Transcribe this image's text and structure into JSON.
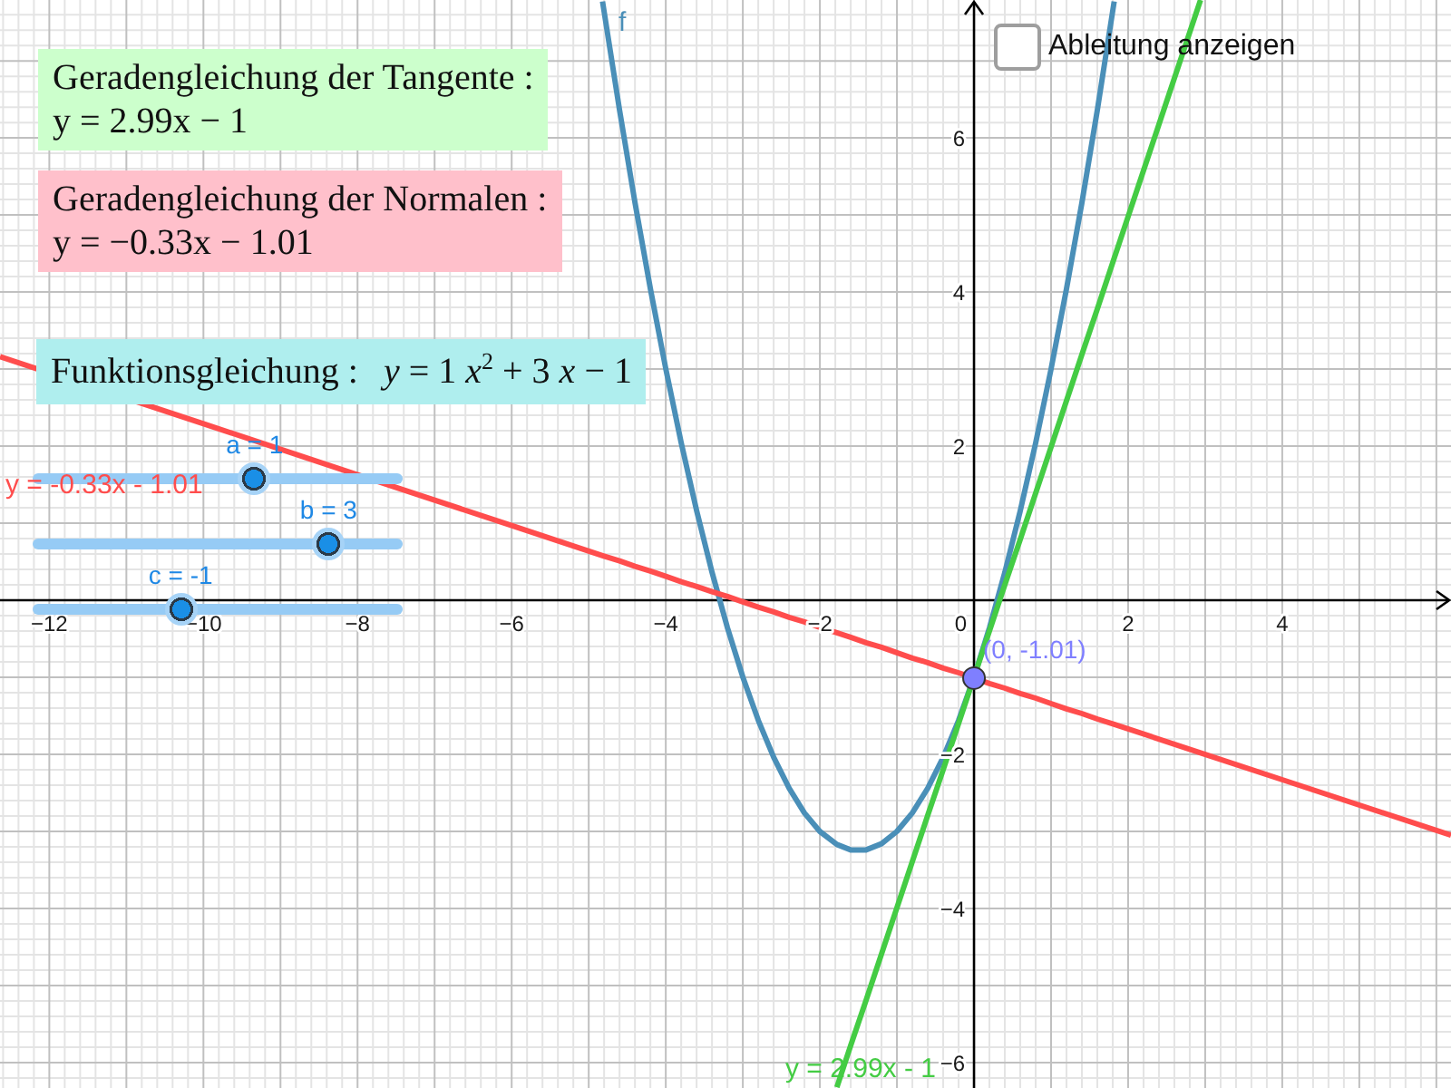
{
  "text_boxes": [
    {
      "kind": "stacked",
      "title": "Geradengleichung der Tangente :",
      "equation": "y = 2.99x − 1",
      "color": "#ccffcc"
    },
    {
      "kind": "stacked",
      "title": "Geradengleichung der Normalen :",
      "equation": "y = −0.33x − 1.01",
      "color": "#ffc0cb"
    },
    {
      "kind": "inline",
      "title": "Funktionsgleichung :",
      "equation": "*y* = 1 *x*$^{2}$ + 3 *x* − 1",
      "color": "#afeeee"
    }
  ],
  "checkbox": {
    "label": "Ableitung anzeigen",
    "checked": false
  },
  "sliders": [
    {
      "label": "a = 1",
      "level": 0.6
    },
    {
      "label": "b = 3",
      "level": 0.8
    },
    {
      "label": "c = -1",
      "level": 0.4
    }
  ],
  "graph": {
    "origin_label": "0",
    "chart_data": {
      "type": "line",
      "grid": true,
      "xlim": [
        -12.64,
        6.19
      ],
      "ylim": [
        -6.33,
        7.79
      ],
      "xticks": [
        {
          "value": -12,
          "label": "−12"
        },
        {
          "value": -10,
          "label": "−10"
        },
        {
          "value": -8,
          "label": "−8"
        },
        {
          "value": -6,
          "label": "−6"
        },
        {
          "value": -4,
          "label": "−4"
        },
        {
          "value": -2,
          "label": "−2"
        },
        2,
        4
      ],
      "yticks": [
        {
          "value": -6,
          "label": "−6"
        },
        {
          "value": -4,
          "label": "−4"
        },
        {
          "value": -2,
          "label": "−2"
        },
        2,
        4,
        6
      ],
      "x": [
        -12.64,
        -10,
        -8,
        -6,
        -4.82,
        -4.6,
        -4.4,
        -4.2,
        -4,
        -3.8,
        -3.6,
        -3.4,
        -3.2,
        -3,
        -2.8,
        -2.6,
        -2.4,
        -2.2,
        -2,
        -1.78,
        -1.6,
        -1.4,
        -1.2,
        -1,
        -0.8,
        -0.6,
        -0.4,
        -0.2,
        0,
        0.2,
        0.4,
        0.6,
        0.8,
        1,
        1.2,
        1.4,
        1.6,
        1.82,
        2.94,
        4,
        6.19
      ],
      "series": [
        {
          "name": "f",
          "color": "#4a8fb8",
          "values": [
            null,
            null,
            null,
            null,
            7.77,
            6.36,
            5.16,
            4.04,
            3,
            2.04,
            1.16,
            0.36,
            -0.36,
            -1,
            -1.56,
            -2.04,
            -2.44,
            -2.76,
            -3,
            -3.17,
            -3.24,
            -3.24,
            -3.16,
            -3,
            -2.76,
            -2.44,
            -2.04,
            -1.56,
            -1,
            -0.36,
            0.36,
            1.16,
            2.04,
            3,
            4.04,
            5.16,
            6.36,
            7.77,
            null,
            null,
            null
          ]
        },
        {
          "name": "y = 2.99x - 1",
          "color": "#44cc44",
          "values": [
            null,
            null,
            null,
            null,
            null,
            null,
            null,
            null,
            null,
            null,
            null,
            null,
            null,
            null,
            null,
            null,
            null,
            null,
            null,
            -6.32,
            -5.78,
            -5.19,
            -4.59,
            -3.99,
            -3.39,
            -2.79,
            -2.2,
            -1.6,
            -1,
            -0.4,
            0.2,
            0.79,
            1.39,
            1.99,
            2.59,
            3.19,
            3.78,
            4.44,
            7.79,
            null,
            null
          ]
        },
        {
          "name": "y = -0.33x - 1.01",
          "color": "#ff4d4d",
          "values": [
            3.16,
            2.29,
            1.63,
            0.97,
            0.58,
            0.51,
            0.44,
            0.38,
            0.31,
            0.24,
            0.18,
            0.11,
            0.05,
            -0.02,
            -0.09,
            -0.15,
            -0.22,
            -0.28,
            -0.35,
            -0.42,
            -0.48,
            -0.55,
            -0.61,
            -0.68,
            -0.75,
            -0.81,
            -0.88,
            -0.94,
            -1.01,
            -1.08,
            -1.14,
            -1.21,
            -1.27,
            -1.34,
            -1.41,
            -1.47,
            -1.54,
            -1.61,
            -1.98,
            -2.33,
            -3.05
          ]
        }
      ],
      "annotations": [
        {
          "x": 0,
          "y": -1.01,
          "text": "(0, -1.01)"
        }
      ]
    }
  }
}
